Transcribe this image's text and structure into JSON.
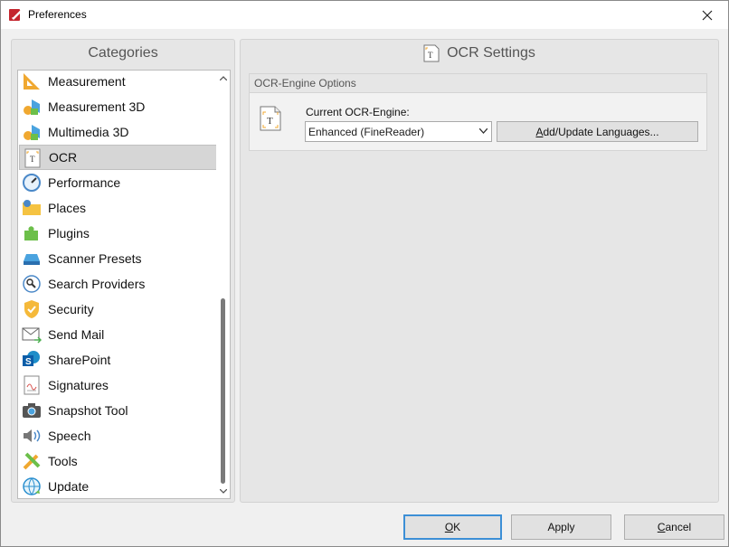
{
  "window": {
    "title": "Preferences",
    "close_glyph": "✕"
  },
  "categories": {
    "header": "Categories",
    "selected_index": 3,
    "items": [
      {
        "label": "Measurement",
        "icon": "measurement-icon"
      },
      {
        "label": "Measurement 3D",
        "icon": "measurement-3d-icon"
      },
      {
        "label": "Multimedia 3D",
        "icon": "multimedia-3d-icon"
      },
      {
        "label": "OCR",
        "icon": "ocr-icon"
      },
      {
        "label": "Performance",
        "icon": "performance-icon"
      },
      {
        "label": "Places",
        "icon": "places-folder-icon"
      },
      {
        "label": "Plugins",
        "icon": "plugins-puzzle-icon"
      },
      {
        "label": "Scanner Presets",
        "icon": "scanner-icon"
      },
      {
        "label": "Search Providers",
        "icon": "search-providers-icon"
      },
      {
        "label": "Security",
        "icon": "security-shield-icon"
      },
      {
        "label": "Send Mail",
        "icon": "send-mail-icon"
      },
      {
        "label": "SharePoint",
        "icon": "sharepoint-icon"
      },
      {
        "label": "Signatures",
        "icon": "signatures-icon"
      },
      {
        "label": "Snapshot Tool",
        "icon": "snapshot-camera-icon"
      },
      {
        "label": "Speech",
        "icon": "speech-speaker-icon"
      },
      {
        "label": "Tools",
        "icon": "tools-icon"
      },
      {
        "label": "Update",
        "icon": "update-globe-icon"
      }
    ]
  },
  "settings": {
    "header": "OCR Settings",
    "group_title": "OCR-Engine Options",
    "engine_label": "Current OCR-Engine:",
    "engine_value": "Enhanced (FineReader)",
    "add_languages_pre": "",
    "add_languages_key": "A",
    "add_languages_post": "dd/Update Languages..."
  },
  "footer": {
    "ok_key": "O",
    "ok_rest": "K",
    "apply": "Apply",
    "cancel_key": "C",
    "cancel_rest": "ancel"
  },
  "colors": {
    "accent": "#3c8fd6",
    "selection": "#d6d6d6",
    "panel": "#e6e6e6"
  }
}
